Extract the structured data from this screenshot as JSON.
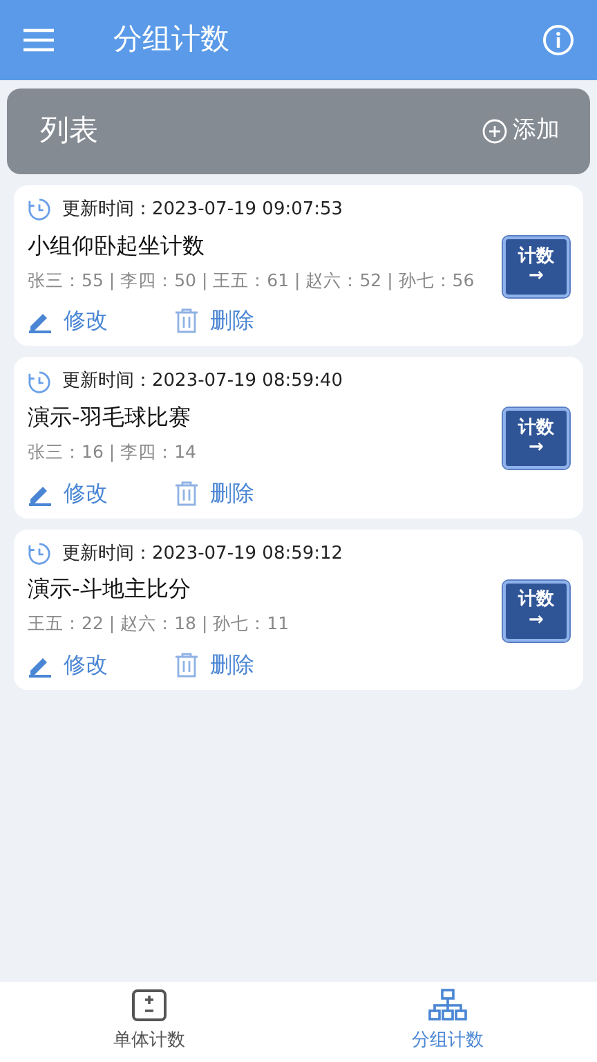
{
  "app_bar": {
    "title": "分组计数"
  },
  "list_header": {
    "title": "列表",
    "add_label": "添加"
  },
  "groups": [
    {
      "updated": "更新时间：2023-07-19 09:07:53",
      "name": "小组仰卧起坐计数",
      "scores": "张三：55 | 李四：50 | 王五：61 | 赵六：52 | 孙七：56",
      "edit": "修改",
      "delete": "删除",
      "count_label": "计数",
      "count_arrow": "→"
    },
    {
      "updated": "更新时间：2023-07-19 08:59:40",
      "name": "演示-羽毛球比赛",
      "scores": "张三：16 | 李四：14",
      "edit": "修改",
      "delete": "删除",
      "count_label": "计数",
      "count_arrow": "→"
    },
    {
      "updated": "更新时间：2023-07-19 08:59:12",
      "name": "演示-斗地主比分",
      "scores": "王五：22 | 赵六：18 | 孙七：11",
      "edit": "修改",
      "delete": "删除",
      "count_label": "计数",
      "count_arrow": "→"
    }
  ],
  "bottom_tabs": [
    {
      "label": "单体计数",
      "kind": "single",
      "selected": false
    },
    {
      "label": "分组计数",
      "kind": "group",
      "selected": true
    }
  ]
}
